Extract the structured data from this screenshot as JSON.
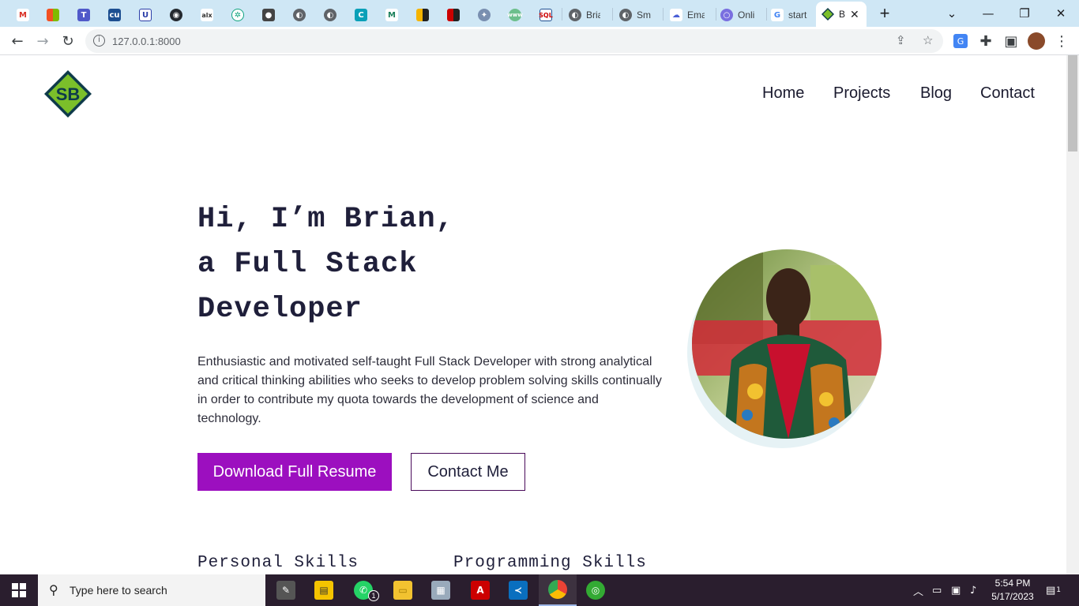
{
  "browser": {
    "active_tab_title": "B",
    "tabs": [
      {
        "icon": "gmail-icon",
        "title": ""
      },
      {
        "icon": "microsoft-icon",
        "title": ""
      },
      {
        "icon": "teams-icon",
        "title": ""
      },
      {
        "icon": "cu-icon",
        "title": ""
      },
      {
        "icon": "udemy-icon",
        "title": ""
      },
      {
        "icon": "github-icon",
        "title": ""
      },
      {
        "icon": "alx-icon",
        "title": ""
      },
      {
        "icon": "chatgpt-icon",
        "title": ""
      },
      {
        "icon": "profile-icon",
        "title": ""
      },
      {
        "icon": "globe-icon",
        "title": ""
      },
      {
        "icon": "globe-icon",
        "title": ""
      },
      {
        "icon": "coursera-icon",
        "title": ""
      },
      {
        "icon": "medium-icon",
        "title": ""
      },
      {
        "icon": "app-icon",
        "title": ""
      },
      {
        "icon": "app-icon",
        "title": ""
      },
      {
        "icon": "seal-icon",
        "title": ""
      },
      {
        "icon": "web-icon",
        "title": ""
      },
      {
        "icon": "sql-icon",
        "title": ""
      },
      {
        "icon": "globe-icon",
        "title": "Brian"
      },
      {
        "icon": "globe-icon",
        "title": "Smtp"
      },
      {
        "icon": "cloud-icon",
        "title": "Ema"
      },
      {
        "icon": "circle-icon",
        "title": "Onli"
      },
      {
        "icon": "google-icon",
        "title": "start"
      }
    ],
    "url": "127.0.0.1:8000"
  },
  "site": {
    "nav": [
      "Home",
      "Projects",
      "Blog",
      "Contact"
    ],
    "logo_text": "SB",
    "hero": {
      "line1": "Hi, I’m Brian,",
      "line2": "a Full Stack",
      "line3": "Developer",
      "description": "Enthusiastic and motivated self-taught Full Stack Developer with strong analytical and critical thinking abilities who seeks to develop problem solving skills continually in order to contribute my quota towards the development of science and technology.",
      "primary_button": "Download Full Resume",
      "secondary_button": "Contact Me"
    },
    "skills": {
      "personal": "Personal Skills",
      "programming": "Programming Skills"
    }
  },
  "taskbar": {
    "search_placeholder": "Type here to search",
    "time": "5:54 PM",
    "date": "5/17/2023",
    "notification_count": "1",
    "whatsapp_badge": "1"
  },
  "colors": {
    "primary": "#9c0fbf",
    "heading": "#1f1f3a",
    "tabstrip": "#cfe7f5",
    "taskbar": "#2a1e2e"
  }
}
